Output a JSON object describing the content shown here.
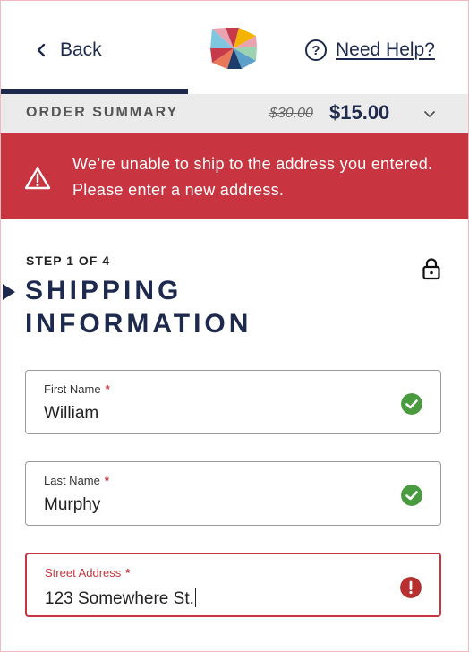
{
  "nav": {
    "back_label": "Back",
    "help_label": "Need Help?",
    "progress_fraction": 0.4
  },
  "summary": {
    "title": "ORDER SUMMARY",
    "old_price": "$30.00",
    "new_price": "$15.00"
  },
  "alert": {
    "message": "We’re unable to ship to the address you entered. Please enter a new address."
  },
  "step": {
    "counter": "STEP 1 OF 4",
    "title": "SHIPPING INFORMATION"
  },
  "fields": {
    "first_name": {
      "label": "First Name",
      "required_mark": "*",
      "value": "William"
    },
    "last_name": {
      "label": "Last Name",
      "required_mark": "*",
      "value": "Murphy"
    },
    "street": {
      "label": "Street Address",
      "required_mark": "*",
      "value": "123 Somewhere St."
    }
  },
  "icons": {
    "back": "chevron-left-icon",
    "help": "question-circle-icon",
    "caret": "chevron-down-icon",
    "alert": "warning-triangle-icon",
    "lock": "lock-icon",
    "valid": "check-circle-icon",
    "invalid": "exclamation-circle-icon"
  },
  "colors": {
    "navy": "#1d2a4d",
    "alert_red": "#c8343f",
    "success_green": "#4a9a3f",
    "summary_bg": "#ebebeb"
  }
}
